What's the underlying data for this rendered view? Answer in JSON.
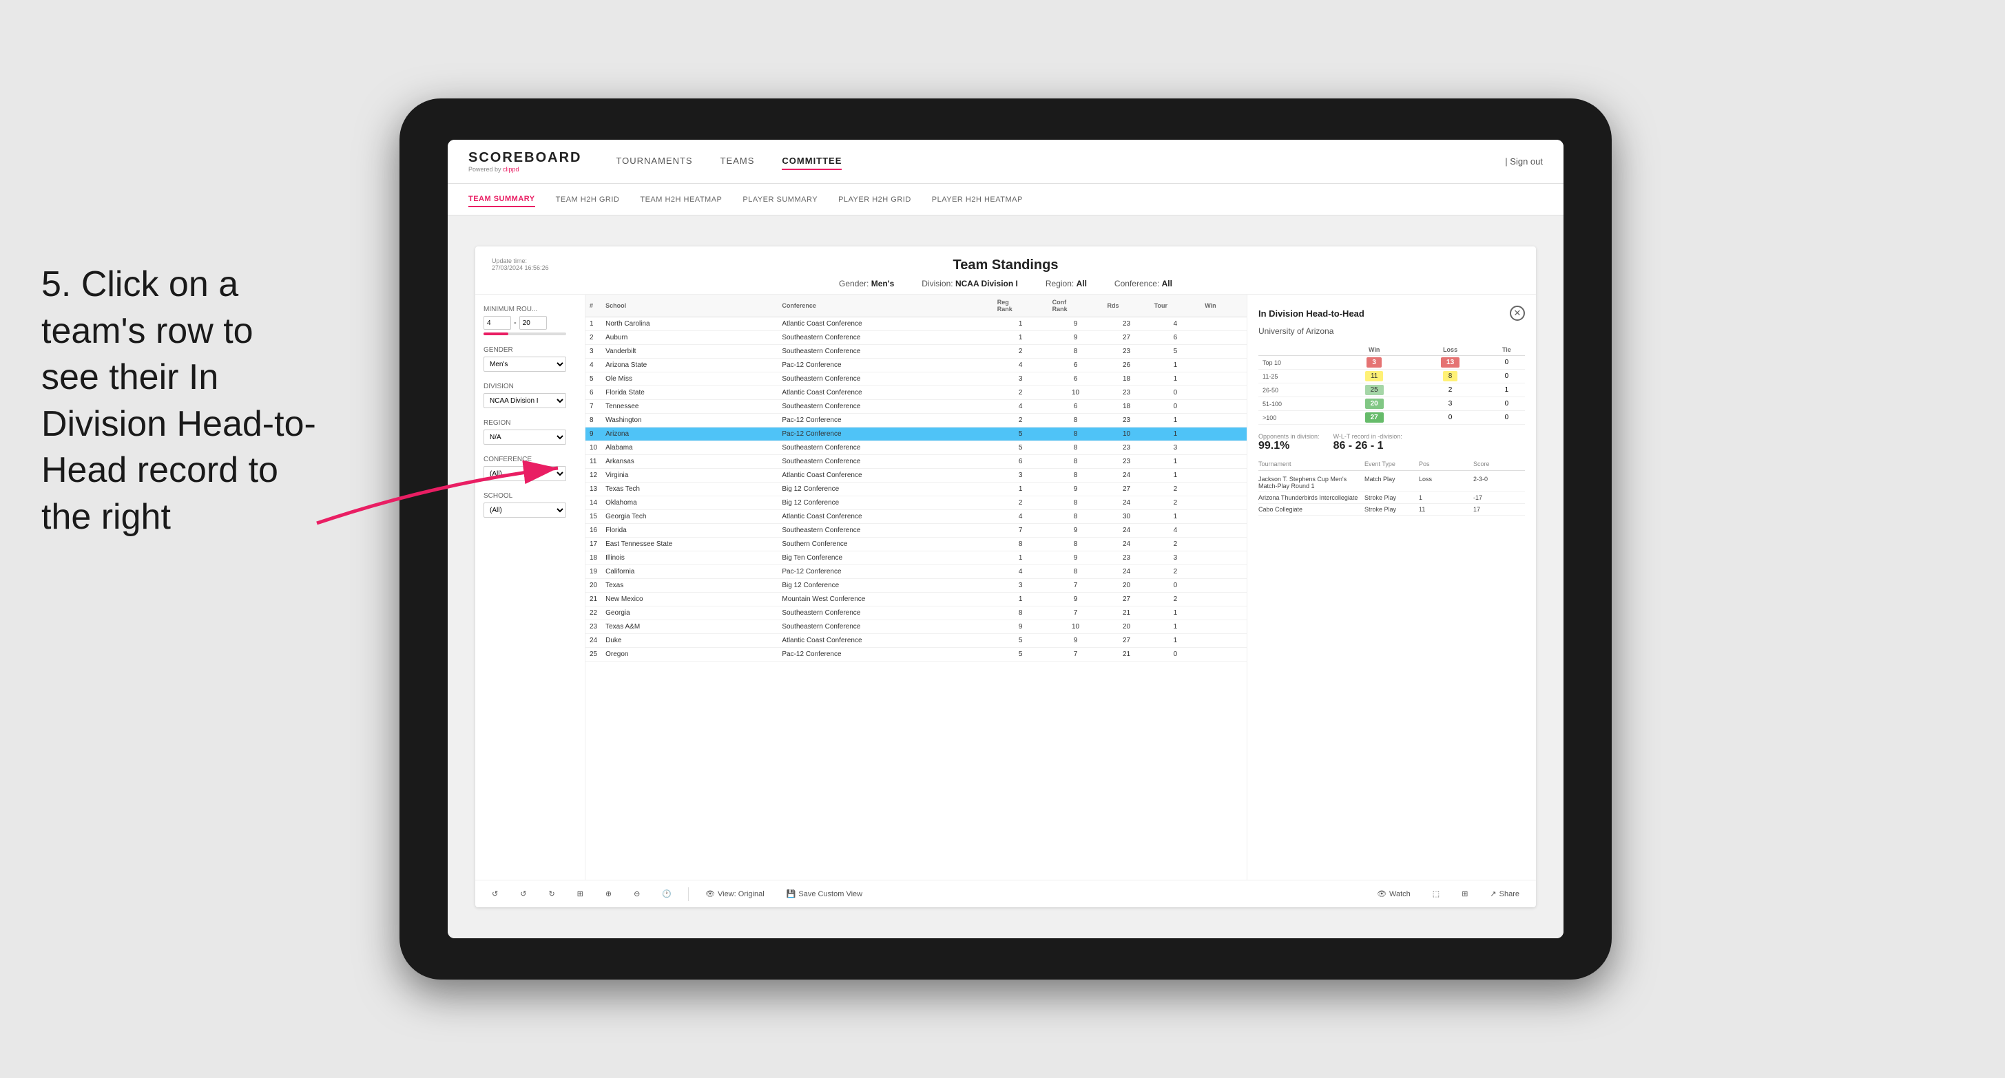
{
  "annotation": {
    "text": "5. Click on a team's row to see their In Division Head-to-Head record to the right"
  },
  "nav": {
    "logo": "SCOREBOARD",
    "logo_sub": "Powered by ",
    "logo_brand": "clippd",
    "items": [
      {
        "label": "TOURNAMENTS",
        "active": false
      },
      {
        "label": "TEAMS",
        "active": false
      },
      {
        "label": "COMMITTEE",
        "active": true
      }
    ],
    "sign_out": "Sign out"
  },
  "sub_nav": {
    "items": [
      {
        "label": "TEAM SUMMARY",
        "active": true
      },
      {
        "label": "TEAM H2H GRID",
        "active": false
      },
      {
        "label": "TEAM H2H HEATMAP",
        "active": false
      },
      {
        "label": "PLAYER SUMMARY",
        "active": false
      },
      {
        "label": "PLAYER H2H GRID",
        "active": false
      },
      {
        "label": "PLAYER H2H HEATMAP",
        "active": false
      }
    ]
  },
  "panel": {
    "update_time": "Update time:",
    "update_date": "27/03/2024 16:56:26",
    "title": "Team Standings",
    "gender_label": "Gender:",
    "gender_value": "Men's",
    "division_label": "Division:",
    "division_value": "NCAA Division I",
    "region_label": "Region:",
    "region_value": "All",
    "conference_label": "Conference:",
    "conference_value": "All"
  },
  "filters": {
    "min_rounds_label": "Minimum Rou...",
    "min_rounds_value": "4",
    "max_rounds_value": "20",
    "gender_label": "Gender",
    "gender_value": "Men's",
    "division_label": "Division",
    "division_value": "NCAA Division I",
    "region_label": "Region",
    "region_value": "N/A",
    "conference_label": "Conference",
    "conference_value": "(All)",
    "school_label": "School",
    "school_value": "(All)"
  },
  "table": {
    "headers": [
      "#",
      "School",
      "Conference",
      "Reg Rank",
      "Conf Rank",
      "Rds",
      "Tour",
      "Win"
    ],
    "rows": [
      {
        "rank": 1,
        "school": "North Carolina",
        "conference": "Atlantic Coast Conference",
        "reg_rank": 1,
        "conf_rank": 9,
        "rds": 23,
        "tour": 4,
        "win": "",
        "highlighted": false
      },
      {
        "rank": 2,
        "school": "Auburn",
        "conference": "Southeastern Conference",
        "reg_rank": 1,
        "conf_rank": 9,
        "rds": 27,
        "tour": 6,
        "win": "",
        "highlighted": false
      },
      {
        "rank": 3,
        "school": "Vanderbilt",
        "conference": "Southeastern Conference",
        "reg_rank": 2,
        "conf_rank": 8,
        "rds": 23,
        "tour": 5,
        "win": "",
        "highlighted": false
      },
      {
        "rank": 4,
        "school": "Arizona State",
        "conference": "Pac-12 Conference",
        "reg_rank": 4,
        "conf_rank": 6,
        "rds": 26,
        "tour": 1,
        "win": "",
        "highlighted": false
      },
      {
        "rank": 5,
        "school": "Ole Miss",
        "conference": "Southeastern Conference",
        "reg_rank": 3,
        "conf_rank": 6,
        "rds": 18,
        "tour": 1,
        "win": "",
        "highlighted": false
      },
      {
        "rank": 6,
        "school": "Florida State",
        "conference": "Atlantic Coast Conference",
        "reg_rank": 2,
        "conf_rank": 10,
        "rds": 23,
        "tour": 0,
        "win": "",
        "highlighted": false
      },
      {
        "rank": 7,
        "school": "Tennessee",
        "conference": "Southeastern Conference",
        "reg_rank": 4,
        "conf_rank": 6,
        "rds": 18,
        "tour": 0,
        "win": "",
        "highlighted": false
      },
      {
        "rank": 8,
        "school": "Washington",
        "conference": "Pac-12 Conference",
        "reg_rank": 2,
        "conf_rank": 8,
        "rds": 23,
        "tour": 1,
        "win": "",
        "highlighted": false
      },
      {
        "rank": 9,
        "school": "Arizona",
        "conference": "Pac-12 Conference",
        "reg_rank": 5,
        "conf_rank": 8,
        "rds": 10,
        "tour": 1,
        "win": "",
        "highlighted": true
      },
      {
        "rank": 10,
        "school": "Alabama",
        "conference": "Southeastern Conference",
        "reg_rank": 5,
        "conf_rank": 8,
        "rds": 23,
        "tour": 3,
        "win": "",
        "highlighted": false
      },
      {
        "rank": 11,
        "school": "Arkansas",
        "conference": "Southeastern Conference",
        "reg_rank": 6,
        "conf_rank": 8,
        "rds": 23,
        "tour": 1,
        "win": "",
        "highlighted": false
      },
      {
        "rank": 12,
        "school": "Virginia",
        "conference": "Atlantic Coast Conference",
        "reg_rank": 3,
        "conf_rank": 8,
        "rds": 24,
        "tour": 1,
        "win": "",
        "highlighted": false
      },
      {
        "rank": 13,
        "school": "Texas Tech",
        "conference": "Big 12 Conference",
        "reg_rank": 1,
        "conf_rank": 9,
        "rds": 27,
        "tour": 2,
        "win": "",
        "highlighted": false
      },
      {
        "rank": 14,
        "school": "Oklahoma",
        "conference": "Big 12 Conference",
        "reg_rank": 2,
        "conf_rank": 8,
        "rds": 24,
        "tour": 2,
        "win": "",
        "highlighted": false
      },
      {
        "rank": 15,
        "school": "Georgia Tech",
        "conference": "Atlantic Coast Conference",
        "reg_rank": 4,
        "conf_rank": 8,
        "rds": 30,
        "tour": 1,
        "win": "",
        "highlighted": false
      },
      {
        "rank": 16,
        "school": "Florida",
        "conference": "Southeastern Conference",
        "reg_rank": 7,
        "conf_rank": 9,
        "rds": 24,
        "tour": 4,
        "win": "",
        "highlighted": false
      },
      {
        "rank": 17,
        "school": "East Tennessee State",
        "conference": "Southern Conference",
        "reg_rank": 8,
        "conf_rank": 8,
        "rds": 24,
        "tour": 2,
        "win": "",
        "highlighted": false
      },
      {
        "rank": 18,
        "school": "Illinois",
        "conference": "Big Ten Conference",
        "reg_rank": 1,
        "conf_rank": 9,
        "rds": 23,
        "tour": 3,
        "win": "",
        "highlighted": false
      },
      {
        "rank": 19,
        "school": "California",
        "conference": "Pac-12 Conference",
        "reg_rank": 4,
        "conf_rank": 8,
        "rds": 24,
        "tour": 2,
        "win": "",
        "highlighted": false
      },
      {
        "rank": 20,
        "school": "Texas",
        "conference": "Big 12 Conference",
        "reg_rank": 3,
        "conf_rank": 7,
        "rds": 20,
        "tour": 0,
        "win": "",
        "highlighted": false
      },
      {
        "rank": 21,
        "school": "New Mexico",
        "conference": "Mountain West Conference",
        "reg_rank": 1,
        "conf_rank": 9,
        "rds": 27,
        "tour": 2,
        "win": "",
        "highlighted": false
      },
      {
        "rank": 22,
        "school": "Georgia",
        "conference": "Southeastern Conference",
        "reg_rank": 8,
        "conf_rank": 7,
        "rds": 21,
        "tour": 1,
        "win": "",
        "highlighted": false
      },
      {
        "rank": 23,
        "school": "Texas A&M",
        "conference": "Southeastern Conference",
        "reg_rank": 9,
        "conf_rank": 10,
        "rds": 20,
        "tour": 1,
        "win": "",
        "highlighted": false
      },
      {
        "rank": 24,
        "school": "Duke",
        "conference": "Atlantic Coast Conference",
        "reg_rank": 5,
        "conf_rank": 9,
        "rds": 27,
        "tour": 1,
        "win": "",
        "highlighted": false
      },
      {
        "rank": 25,
        "school": "Oregon",
        "conference": "Pac-12 Conference",
        "reg_rank": 5,
        "conf_rank": 7,
        "rds": 21,
        "tour": 0,
        "win": "",
        "highlighted": false
      }
    ]
  },
  "h2h": {
    "title": "In Division Head-to-Head",
    "team": "University of Arizona",
    "win_label": "Win",
    "loss_label": "Loss",
    "tie_label": "Tie",
    "rows": [
      {
        "range": "Top 10",
        "win": 3,
        "loss": 13,
        "tie": 0,
        "win_class": "cell-red",
        "loss_class": "cell-red"
      },
      {
        "range": "11-25",
        "win": 11,
        "loss": 8,
        "tie": 0,
        "win_class": "cell-yellow",
        "loss_class": "cell-yellow"
      },
      {
        "range": "26-50",
        "win": 25,
        "loss": 2,
        "tie": 1,
        "win_class": "cell-light-green",
        "loss_class": ""
      },
      {
        "range": "51-100",
        "win": 20,
        "loss": 3,
        "tie": 0,
        "win_class": "cell-green",
        "loss_class": ""
      },
      {
        "range": ">100",
        "win": 27,
        "loss": 0,
        "tie": 0,
        "win_class": "cell-green2",
        "loss_class": ""
      }
    ],
    "opponents_label": "Opponents in division:",
    "opponents_value": "99.1%",
    "wlt_label": "W-L-T record in -division:",
    "wlt_value": "86 - 26 - 1",
    "tournament_label": "Tournament",
    "event_type_label": "Event Type",
    "pos_label": "Pos",
    "score_label": "Score",
    "tournaments": [
      {
        "name": "Jackson T. Stephens Cup Men's Match-Play Round 1",
        "event_type": "Match Play",
        "pos": "Loss",
        "score": "2-3-0"
      },
      {
        "name": "Arizona Thunderbirds Intercollegiate",
        "event_type": "Stroke Play",
        "pos": "1",
        "score": "-17"
      },
      {
        "name": "Cabo Collegiate",
        "event_type": "Stroke Play",
        "pos": "11",
        "score": "17"
      }
    ]
  },
  "toolbar": {
    "undo": "↺",
    "redo": "↻",
    "view_original": "View: Original",
    "save_custom": "Save Custom View",
    "watch": "Watch",
    "share": "Share"
  }
}
